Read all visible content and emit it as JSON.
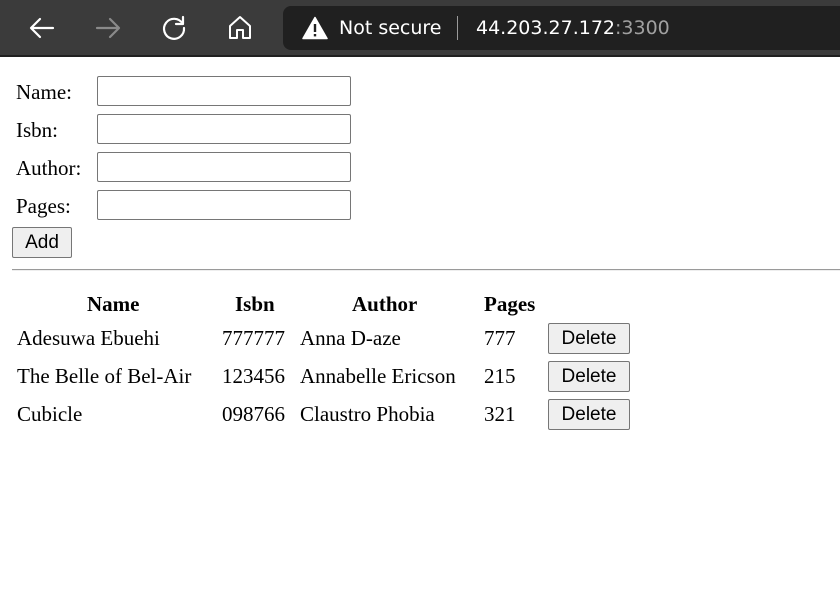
{
  "browser": {
    "back_icon": "arrow-left-icon",
    "forward_icon": "arrow-right-icon",
    "refresh_icon": "refresh-icon",
    "home_icon": "home-icon",
    "security_icon": "warning-triangle-icon",
    "security_text": "Not secure",
    "url_host": "44.203.27.172",
    "url_port": ":3300"
  },
  "form": {
    "fields": [
      {
        "label": "Name:",
        "value": ""
      },
      {
        "label": "Isbn:",
        "value": ""
      },
      {
        "label": "Author:",
        "value": ""
      },
      {
        "label": "Pages:",
        "value": ""
      }
    ],
    "add_label": "Add"
  },
  "table": {
    "headers": [
      "Name",
      "Isbn",
      "Author",
      "Pages"
    ],
    "rows": [
      {
        "name": "Adesuwa Ebuehi",
        "isbn": "777777",
        "author": "Anna D-aze",
        "pages": "777",
        "delete_label": "Delete"
      },
      {
        "name": "The Belle of Bel-Air",
        "isbn": "123456",
        "author": "Annabelle Ericson",
        "pages": "215",
        "delete_label": "Delete"
      },
      {
        "name": "Cubicle",
        "isbn": "098766",
        "author": "Claustro Phobia",
        "pages": "321",
        "delete_label": "Delete"
      }
    ]
  },
  "colors": {
    "toolbar_bg": "#3b3b3b",
    "address_bar_bg": "#202020",
    "button_bg": "#efefef"
  }
}
